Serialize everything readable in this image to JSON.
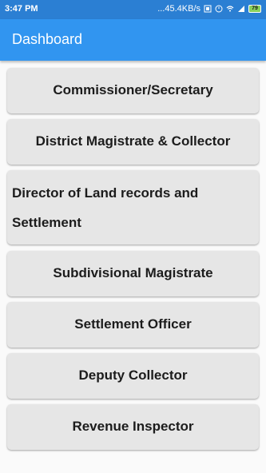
{
  "status_bar": {
    "time": "3:47 PM",
    "network_speed": "...45.4KB/s",
    "battery_level": "79"
  },
  "app_bar": {
    "title": "Dashboard",
    "color": "#3195f0"
  },
  "menu": {
    "items": [
      {
        "label": "Commissioner/Secretary"
      },
      {
        "label": "District Magistrate & Collector"
      },
      {
        "label": "Director of Land records and Settlement"
      },
      {
        "label": "Subdivisional Magistrate"
      },
      {
        "label": "Settlement Officer"
      },
      {
        "label": "Deputy Collector"
      },
      {
        "label": "Revenue Inspector"
      }
    ]
  }
}
